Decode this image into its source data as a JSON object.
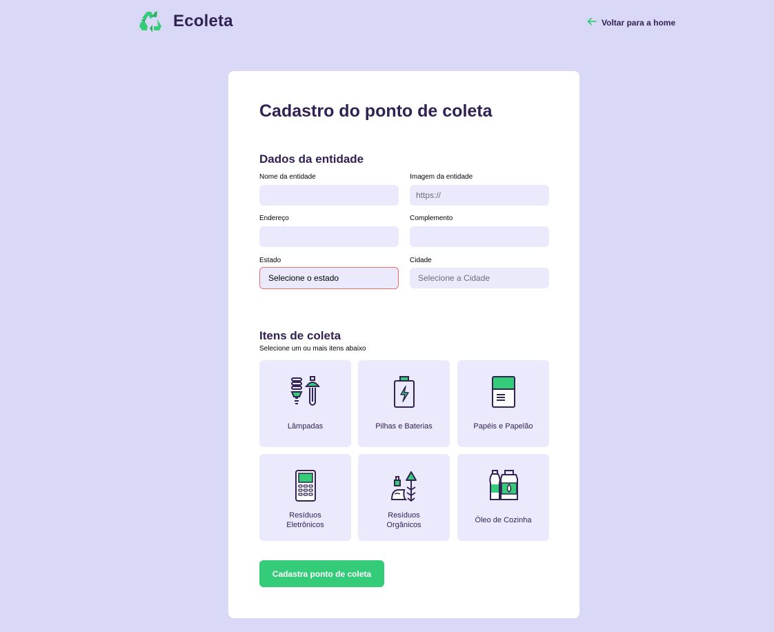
{
  "header": {
    "app_name": "Ecoleta",
    "back_label": "Voltar para a home"
  },
  "form": {
    "title": "Cadastro do ponto de coleta",
    "entity_section": {
      "title": "Dados da entidade",
      "name_label": "Nome da entidade",
      "name_value": "",
      "image_label": "Imagem da entidade",
      "image_placeholder": "https://",
      "address_label": "Endereço",
      "address_value": "",
      "complement_label": "Complemento",
      "complement_value": "",
      "state_label": "Estado",
      "state_value": "Selecione o estado",
      "city_label": "Cidade",
      "city_value": "Selecione a Cidade"
    },
    "items_section": {
      "title": "Itens de coleta",
      "subtitle": "Selecione um ou mais itens abaixo",
      "items": [
        {
          "label": "Lâmpadas",
          "icon": "lamps-icon"
        },
        {
          "label": "Pilhas e Baterias",
          "icon": "battery-icon"
        },
        {
          "label": "Papéis e Papelão",
          "icon": "paper-icon"
        },
        {
          "label": "Resíduos Eletrônicos",
          "icon": "electronics-icon"
        },
        {
          "label": "Resíduos Orgânicos",
          "icon": "organic-icon"
        },
        {
          "label": "Óleo de Cozinha",
          "icon": "oil-icon"
        }
      ]
    },
    "submit_label": "Cadastra ponto de coleta"
  },
  "colors": {
    "background": "#d9d9f7",
    "primary_green": "#34cb79",
    "title_purple": "#322153",
    "field_bg": "#ebeafc",
    "error_border": "#f26b6b"
  }
}
